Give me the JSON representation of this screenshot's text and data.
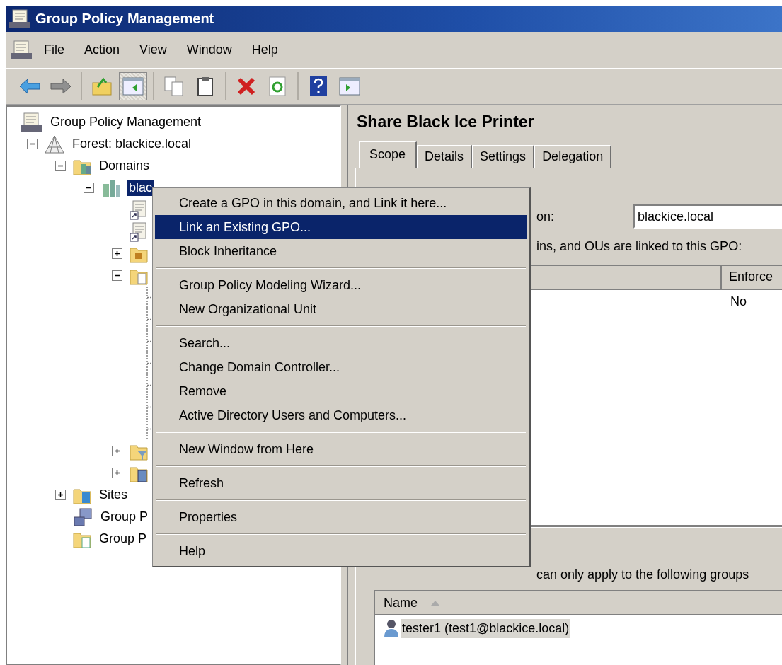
{
  "window": {
    "title": "Group Policy Management"
  },
  "menu_bar": [
    "File",
    "Action",
    "View",
    "Window",
    "Help"
  ],
  "toolbar": [
    [
      {
        "kind": "back",
        "pressed": false
      },
      {
        "kind": "forward",
        "pressed": false
      }
    ],
    [
      {
        "kind": "up-folder",
        "pressed": false
      },
      {
        "kind": "console-tree",
        "pressed": true
      }
    ],
    [
      {
        "kind": "copy",
        "pressed": false
      },
      {
        "kind": "paste",
        "pressed": false
      }
    ],
    [
      {
        "kind": "delete",
        "pressed": false
      },
      {
        "kind": "refresh",
        "pressed": false
      }
    ],
    [
      {
        "kind": "help",
        "pressed": false
      },
      {
        "kind": "action-pane",
        "pressed": false
      }
    ]
  ],
  "tree": {
    "label": "Group Policy Management",
    "kind": "console",
    "selected": false,
    "children": [
      {
        "label": "Forest: blackice.local",
        "kind": "forest",
        "selected": false,
        "expanded": true,
        "children": [
          {
            "label": "Domains",
            "kind": "domains",
            "selected": false,
            "expanded": true,
            "children": [
              {
                "label": "blac",
                "kind": "domain",
                "selected": true,
                "expanded": true,
                "children": [
                  {
                    "kind": "gpo-link"
                  },
                  {
                    "kind": "gpo-link"
                  },
                  {
                    "kind": "folder",
                    "expanded": false
                  },
                  {
                    "kind": "gpo-folder",
                    "expanded": true,
                    "children": [
                      {
                        "kind": "covered"
                      },
                      {
                        "kind": "covered"
                      },
                      {
                        "kind": "covered"
                      },
                      {
                        "kind": "covered"
                      },
                      {
                        "kind": "covered"
                      },
                      {
                        "kind": "covered"
                      },
                      {
                        "kind": "covered"
                      }
                    ]
                  },
                  {
                    "kind": "filter-folder",
                    "expanded": false
                  },
                  {
                    "kind": "starter-folder",
                    "expanded": false
                  }
                ]
              }
            ]
          },
          {
            "label": "Sites",
            "kind": "sites",
            "selected": false,
            "expanded": false
          },
          {
            "label": "Group P",
            "kind": "modeling",
            "selected": false
          },
          {
            "label": "Group P",
            "kind": "results",
            "selected": false
          }
        ]
      }
    ]
  },
  "context_menu": {
    "items": [
      {
        "kind": "item",
        "label": "Create a GPO in this domain, and Link it here...",
        "selected": false
      },
      {
        "kind": "item",
        "label": "Link an Existing GPO...",
        "selected": true
      },
      {
        "kind": "item",
        "label": "Block Inheritance",
        "selected": false
      },
      {
        "kind": "separator"
      },
      {
        "kind": "item",
        "label": "Group Policy Modeling Wizard...",
        "selected": false
      },
      {
        "kind": "item",
        "label": "New Organizational Unit",
        "selected": false
      },
      {
        "kind": "separator"
      },
      {
        "kind": "item",
        "label": "Search...",
        "selected": false
      },
      {
        "kind": "item",
        "label": "Change Domain Controller...",
        "selected": false
      },
      {
        "kind": "item",
        "label": "Remove",
        "selected": false
      },
      {
        "kind": "item",
        "label": "Active Directory Users and Computers...",
        "selected": false
      },
      {
        "kind": "separator"
      },
      {
        "kind": "item",
        "label": "New Window from Here",
        "selected": false
      },
      {
        "kind": "separator"
      },
      {
        "kind": "item",
        "label": "Refresh",
        "selected": false
      },
      {
        "kind": "separator"
      },
      {
        "kind": "item",
        "label": "Properties",
        "selected": false
      },
      {
        "kind": "separator"
      },
      {
        "kind": "item",
        "label": "Help",
        "selected": false
      }
    ]
  },
  "details": {
    "title": "Share Black Ice Printer",
    "tabs": [
      {
        "label": "Scope",
        "selected": true
      },
      {
        "label": "Details",
        "selected": false
      },
      {
        "label": "Settings",
        "selected": false
      },
      {
        "label": "Delegation",
        "selected": false
      }
    ],
    "location_label": "on:",
    "location_value": "blackice.local",
    "links_caption": "ins, and OUs are linked to this GPO:",
    "links_table": {
      "columns": [
        "Enforce"
      ],
      "rows": [
        [
          "No"
        ]
      ]
    },
    "filter_caption": "can only apply to the following groups",
    "filter_list": {
      "columns": [
        {
          "label": "Name",
          "sorted": true
        }
      ],
      "rows": [
        {
          "name": "tester1 (test1@blackice.local)",
          "selected": true
        }
      ]
    }
  }
}
